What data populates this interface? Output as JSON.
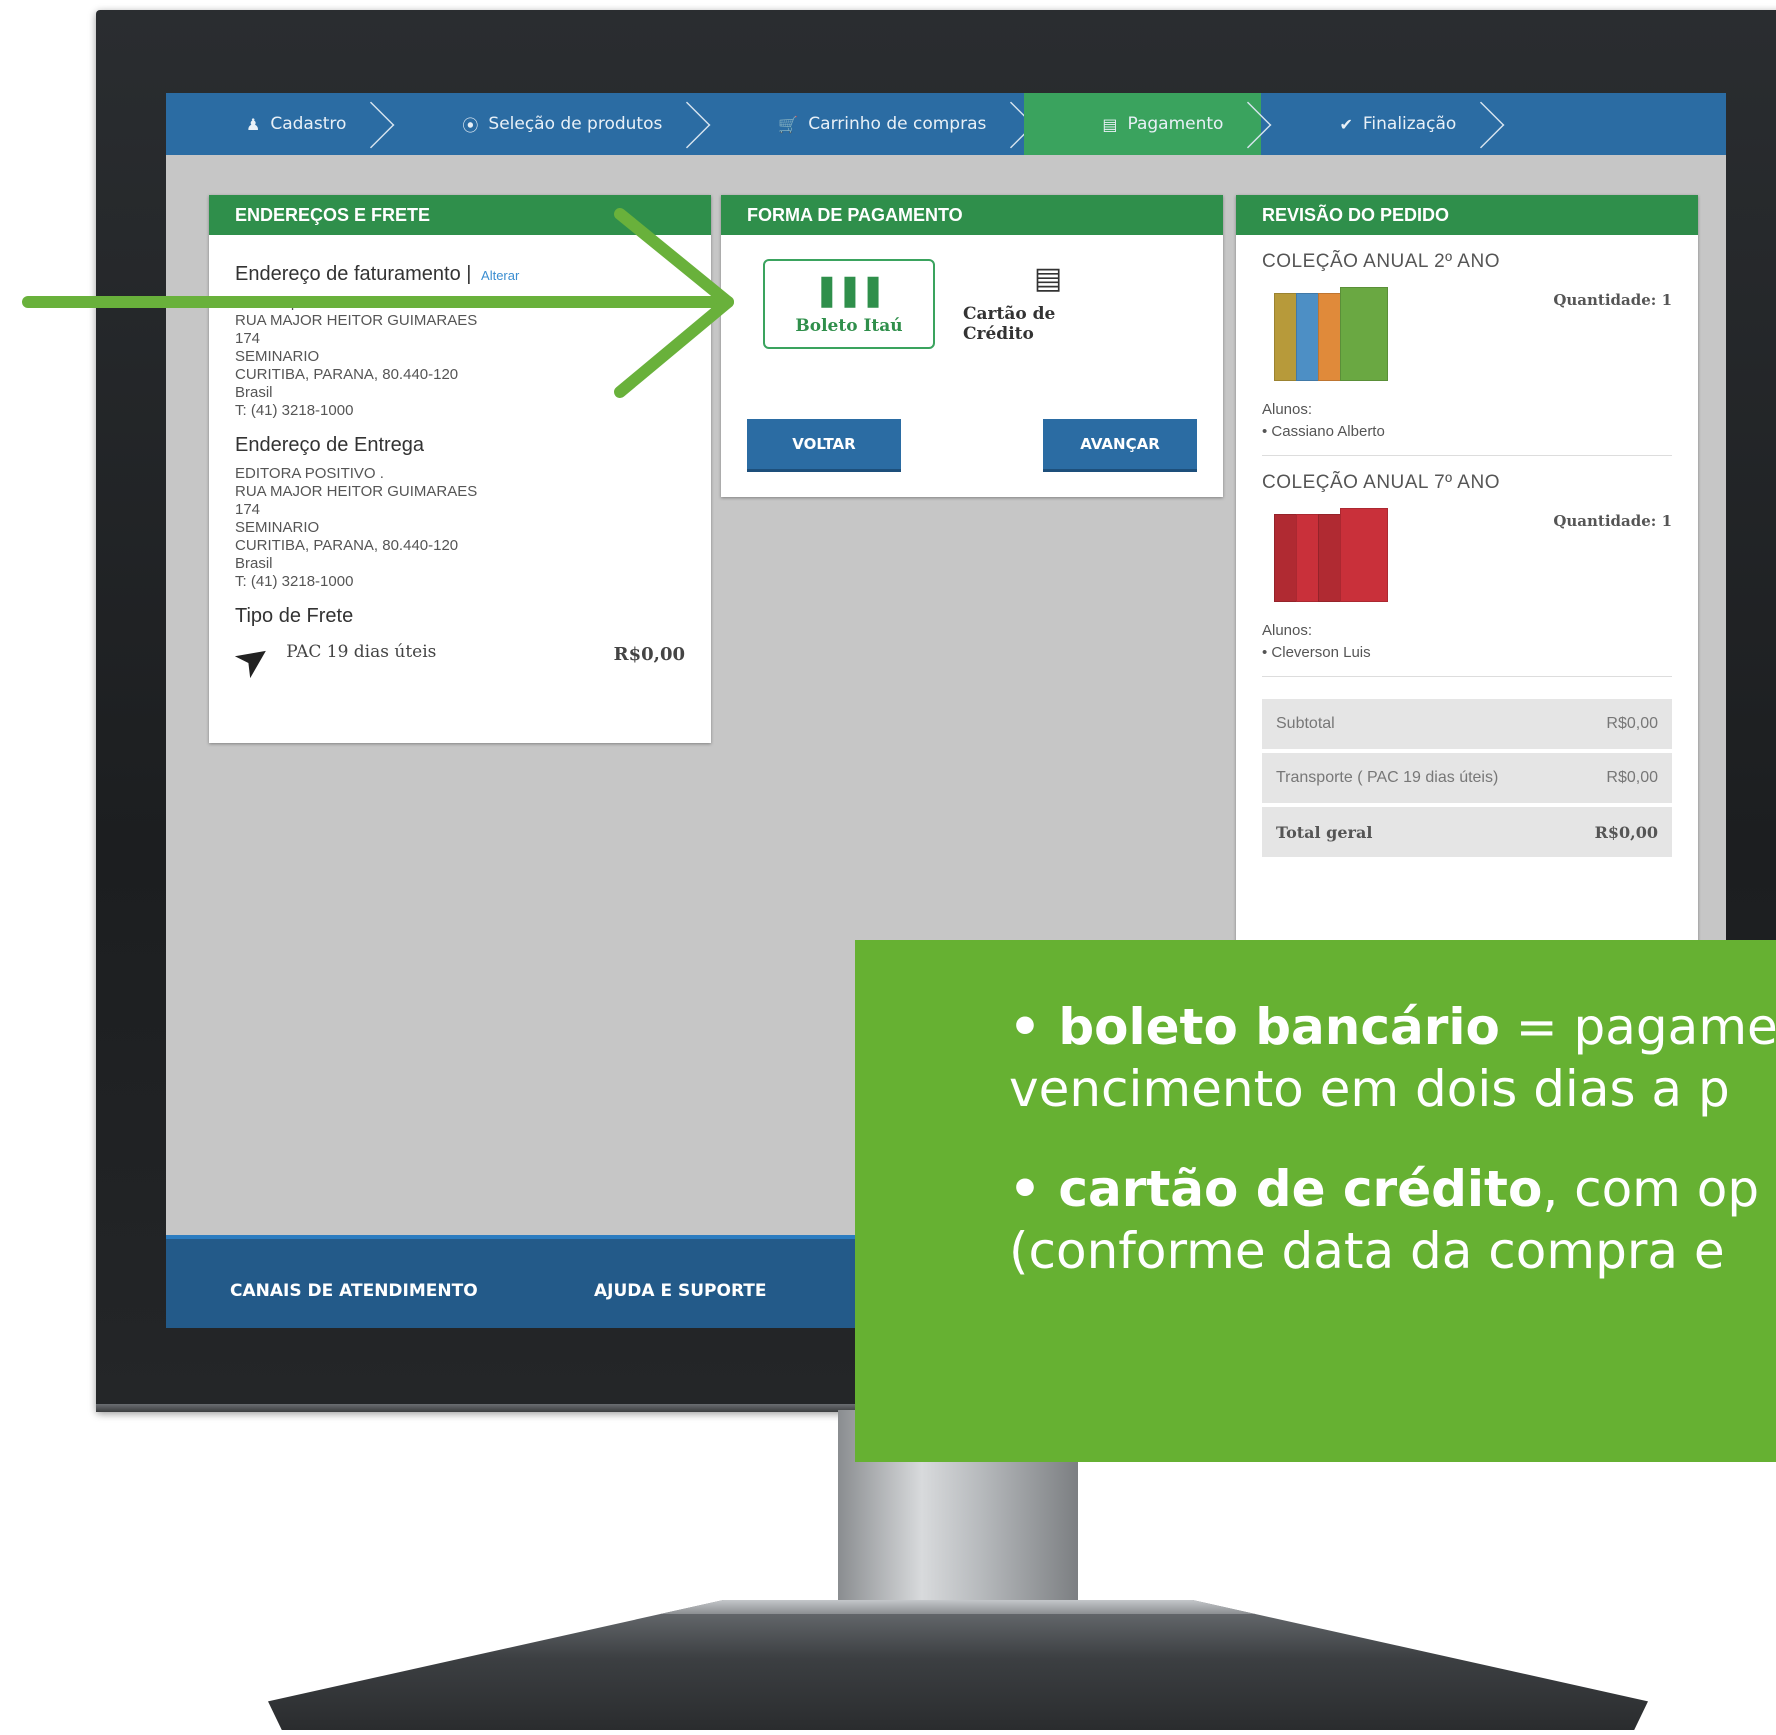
{
  "steps": [
    {
      "icon": "user-icon",
      "label": "Cadastro"
    },
    {
      "icon": "circle-icon",
      "label": "Seleção de produtos"
    },
    {
      "icon": "cart-icon",
      "label": "Carrinho de compras"
    },
    {
      "icon": "card-icon",
      "label": "Pagamento"
    },
    {
      "icon": "check-circle-icon",
      "label": "Finalização"
    }
  ],
  "address_panel": {
    "title": "ENDEREÇOS E FRETE",
    "billing_heading": "Endereço de faturamento |",
    "billing_change": "Alterar",
    "billing_lines": "Luiz Felipe Blum .\nRUA MAJOR HEITOR GUIMARAES\n174\nSEMINARIO\nCURITIBA, PARANA, 80.440-120\nBrasil\nT: (41) 3218-1000",
    "delivery_heading": "Endereço de Entrega",
    "delivery_lines": "EDITORA POSITIVO .\nRUA MAJOR HEITOR GUIMARAES\n174\nSEMINARIO\nCURITIBA, PARANA, 80.440-120\nBrasil\nT: (41) 3218-1000",
    "freight_heading": "Tipo de Frete",
    "freight_name": "PAC 19 dias úteis",
    "freight_price": "R$0,00"
  },
  "payment_panel": {
    "title": "FORMA DE PAGAMENTO",
    "option_boleto": "Boleto Itaú",
    "option_card": "Cartão de Crédito",
    "back": "VOLTAR",
    "next": "AVANÇAR"
  },
  "review_panel": {
    "title": "REVISÃO DO PEDIDO",
    "items": [
      {
        "title": "COLEÇÃO ANUAL 2º ANO",
        "qty_label": "Quantidade:",
        "qty": "1",
        "students_label": "Alunos:",
        "student": "• Cassiano Alberto",
        "cover_color": "#6aa842"
      },
      {
        "title": "COLEÇÃO ANUAL 7º ANO",
        "qty_label": "Quantidade:",
        "qty": "1",
        "students_label": "Alunos:",
        "student": "• Cleverson Luis",
        "cover_color": "#c9303a"
      }
    ],
    "subtotal_label": "Subtotal",
    "subtotal_value": "R$0,00",
    "shipping_label": "Transporte ( PAC 19 dias úteis)",
    "shipping_value": "R$0,00",
    "total_label": "Total geral",
    "total_value": "R$0,00"
  },
  "footer": {
    "channels": "CANAIS DE ATENDIMENTO",
    "help": "AJUDA E SUPORTE"
  },
  "callout": {
    "l1_bold": "• boleto bancário",
    "l1_rest": " = pagame",
    "l2": "vencimento em dois dias a p",
    "l3_bold": "• cartão de crédito",
    "l3_rest": ", com op",
    "l4": "(conforme data da compra e"
  },
  "colors": {
    "nav_blue": "#2b6ca3",
    "active_green": "#3aa35e",
    "panel_head": "#2f8f4b",
    "callout_green": "#66b132",
    "annotation_arrow": "#69b13b"
  }
}
